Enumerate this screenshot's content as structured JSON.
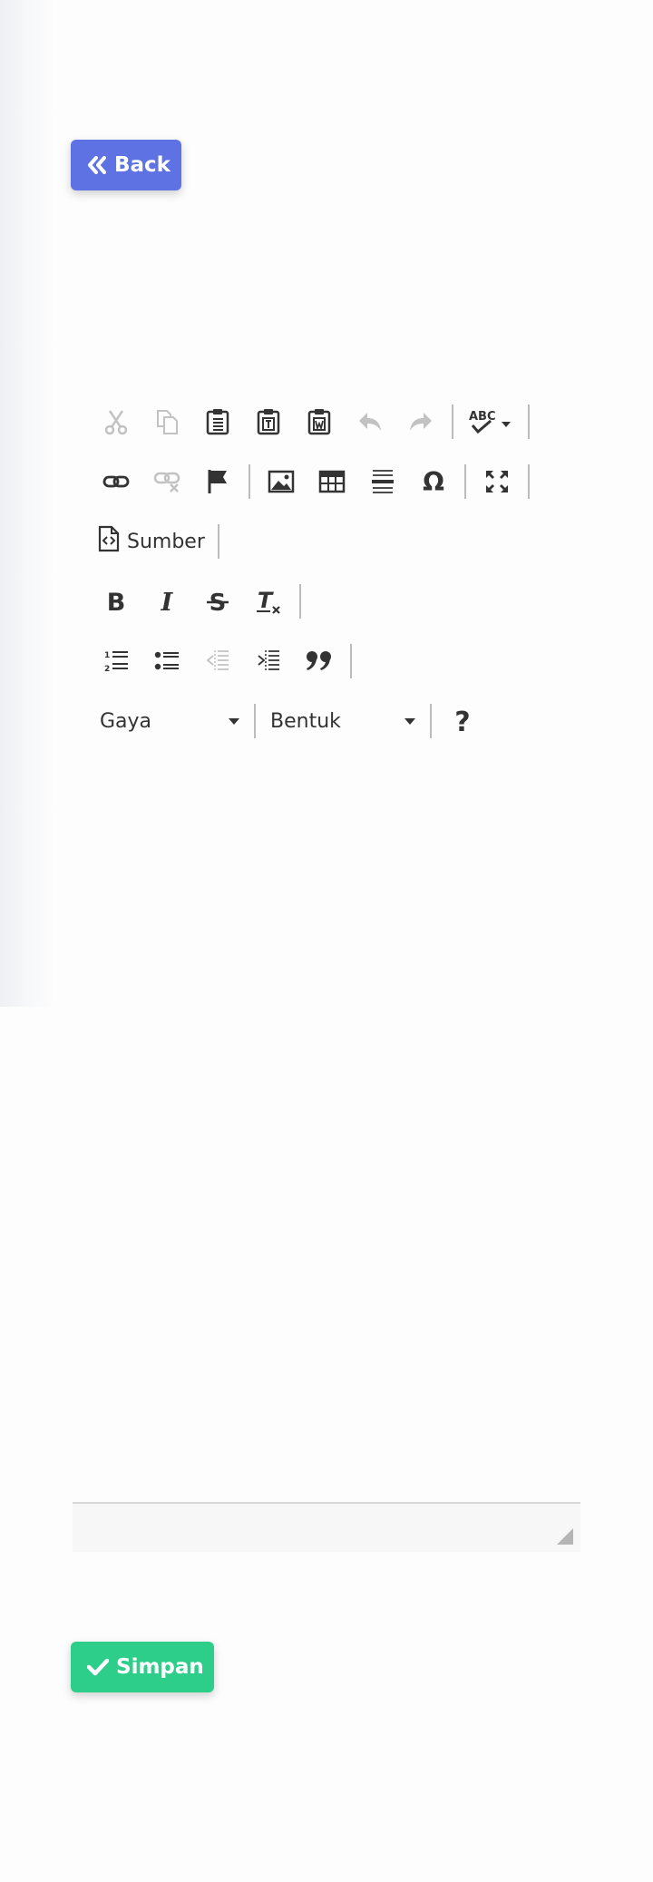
{
  "back_button": {
    "label": "Back",
    "icon": "double-chevron-left-icon",
    "color": "#5e72e4"
  },
  "save_button": {
    "label": "Simpan",
    "icon": "check-icon",
    "color": "#2dce89"
  },
  "editor": {
    "toolbar": {
      "source_label": "Sumber",
      "style_combo": {
        "label": "Gaya"
      },
      "format_combo": {
        "label": "Bentuk"
      }
    },
    "help_icon": "question-icon"
  }
}
